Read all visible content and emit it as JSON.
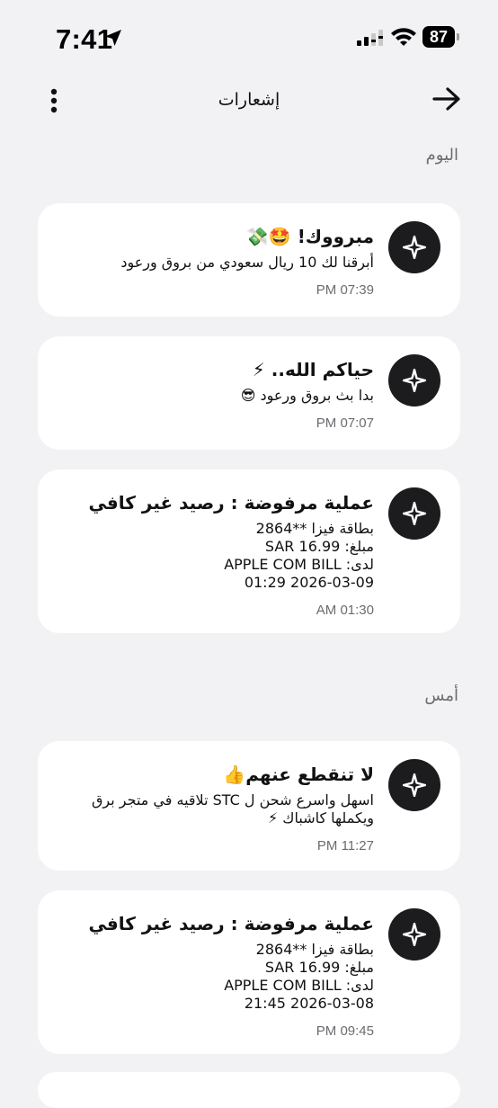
{
  "status_bar": {
    "time": "7:41",
    "battery": "87"
  },
  "header": {
    "title": "إشعارات"
  },
  "sections": [
    {
      "title": "اليوم"
    },
    {
      "title": "أمس"
    }
  ],
  "notifications": [
    {
      "title": "مبرووك!",
      "title_emoji": "🤩💸",
      "body_lines": [
        "أبرقنا لك 10 ريال سعودي من بروق ورعود"
      ],
      "time": "07:39 PM"
    },
    {
      "title": "حياكم الله..",
      "title_emoji": "⚡",
      "body_lines": [
        "بدا بث بروق ورعود 😎"
      ],
      "time": "07:07 PM"
    },
    {
      "title": "عملية مرفوضة : رصيد غير كافي",
      "title_emoji": "",
      "body_lines": [
        "بطاقة فيزا **2864",
        "مبلغ: SAR 16.99",
        "لدى: APPLE COM BILL",
        "2026-03-09 01:29"
      ],
      "time": "01:30 AM"
    },
    {
      "title": "لا تنقطع عنهم",
      "title_emoji": "👍",
      "body_lines": [
        "اسهل واسرع شحن ل STC تلاقيه في متجر برق",
        "ويكملها كاشباك ⚡"
      ],
      "time": "11:27 PM"
    },
    {
      "title": "عملية مرفوضة : رصيد غير كافي",
      "title_emoji": "",
      "body_lines": [
        "بطاقة فيزا **2864",
        "مبلغ: SAR 16.99",
        "لدى: APPLE COM BILL",
        "2026-03-08 21:45"
      ],
      "time": "09:45 PM"
    }
  ],
  "icons": {
    "location": "location-arrow-icon",
    "signal": "cellular-signal-icon",
    "wifi": "wifi-icon",
    "battery": "battery-icon",
    "menu": "kebab-menu-icon",
    "back": "back-arrow-icon",
    "notification": "sparkle-logo-icon"
  },
  "colors": {
    "background": "#f2f2f4",
    "card": "#ffffff",
    "icon_circle": "#1c1c1e",
    "muted_text": "#6b6b70"
  }
}
